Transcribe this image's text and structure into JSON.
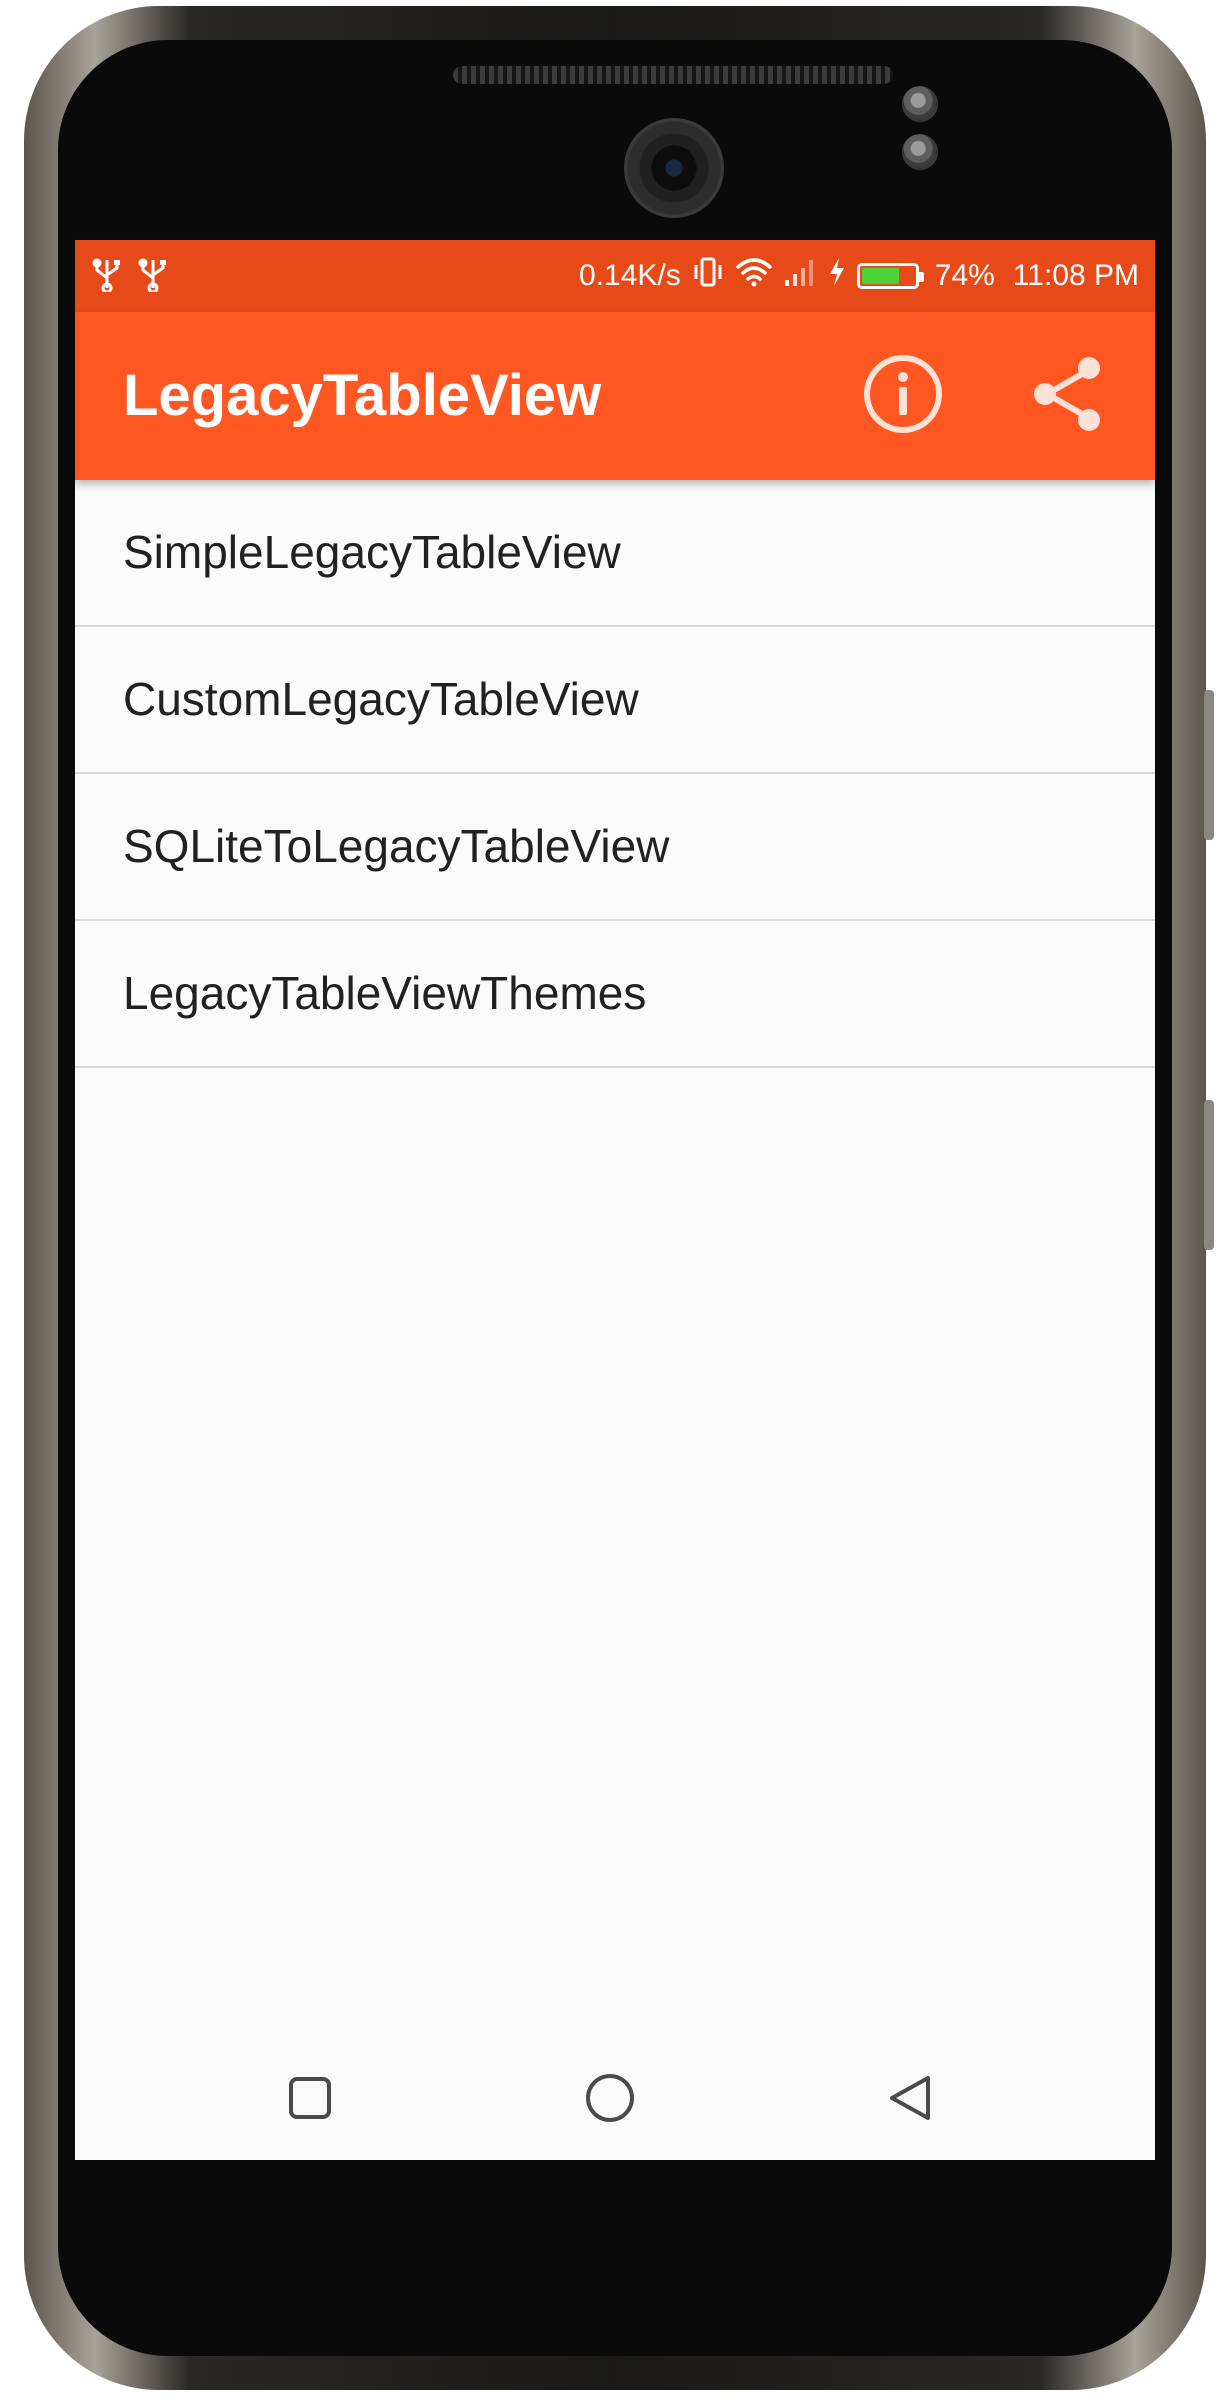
{
  "status_bar": {
    "network_speed": "0.14K/s",
    "battery_percent": "74%",
    "battery_level": 0.74,
    "time": "11:08 PM",
    "left_icons": [
      "usb-icon",
      "usb-icon"
    ],
    "right_icons": [
      "vibrate-icon",
      "wifi-icon",
      "signal-icon",
      "charging-icon",
      "battery-icon"
    ]
  },
  "app_bar": {
    "title": "LegacyTableView",
    "actions": [
      "info-icon",
      "share-icon"
    ]
  },
  "menu_items": [
    {
      "label": "SimpleLegacyTableView"
    },
    {
      "label": "CustomLegacyTableView"
    },
    {
      "label": "SQLiteToLegacyTableView"
    },
    {
      "label": "LegacyTableViewThemes"
    }
  ],
  "nav_bar": {
    "buttons": [
      "recents-icon",
      "home-icon",
      "back-icon"
    ]
  },
  "colors": {
    "status_bar": "#e64a19",
    "app_bar": "#ff5722",
    "background": "#fafafa",
    "divider": "#d9d9d9",
    "text": "#212121",
    "battery_fill": "#4cd137"
  }
}
